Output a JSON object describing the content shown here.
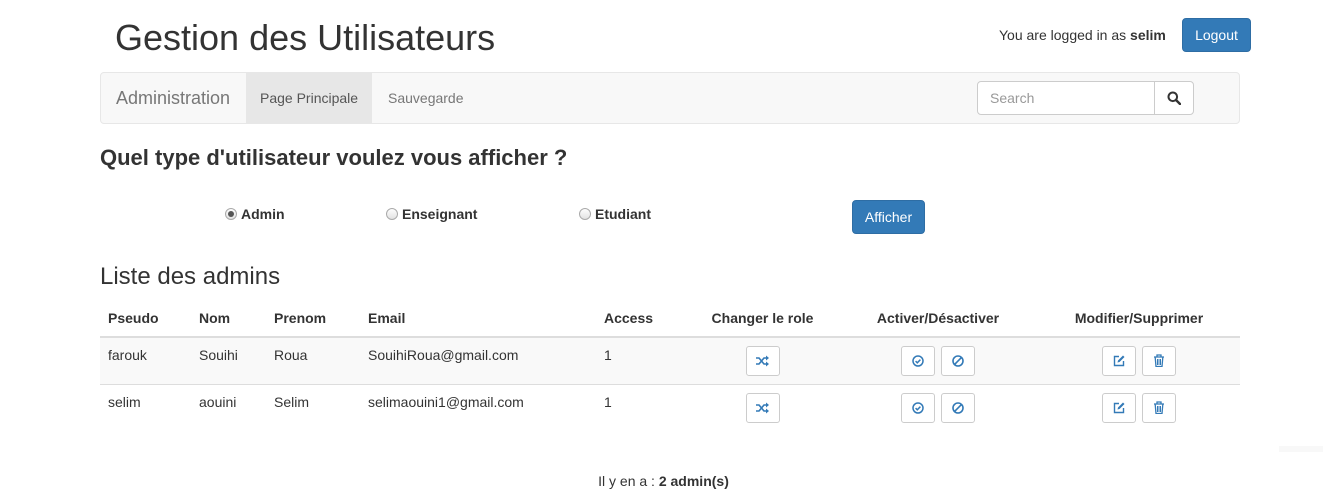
{
  "app_title": "Gestion des Utilisateurs",
  "login": {
    "prefix": "You are logged in as",
    "username": "selim",
    "logout_label": "Logout"
  },
  "navbar": {
    "brand": "Administration",
    "items": [
      {
        "label": "Page Principale",
        "active": true
      },
      {
        "label": "Sauvegarde",
        "active": false
      }
    ],
    "search": {
      "placeholder": "Search",
      "value": ""
    }
  },
  "filter": {
    "question": "Quel type d'utilisateur voulez vous afficher ?",
    "options": [
      {
        "label": "Admin",
        "selected": true
      },
      {
        "label": "Enseignant",
        "selected": false
      },
      {
        "label": "Etudiant",
        "selected": false
      }
    ],
    "submit_label": "Afficher"
  },
  "list": {
    "title": "Liste des admins",
    "columns": [
      "Pseudo",
      "Nom",
      "Prenom",
      "Email",
      "Access",
      "Changer le role",
      "Activer/Désactiver",
      "Modifier/Supprimer"
    ],
    "rows": [
      {
        "pseudo": "farouk",
        "nom": "Souihi",
        "prenom": "Roua",
        "email": "SouihiRoua@gmail.com",
        "access": "1"
      },
      {
        "pseudo": "selim",
        "nom": "aouini",
        "prenom": "Selim",
        "email": "selimaouini1@gmail.com",
        "access": "1"
      }
    ]
  },
  "footer": {
    "prefix": "Il y en a :",
    "count": "2 admin(s)"
  },
  "colors": {
    "primary": "#337ab7",
    "navbar_bg": "#f8f8f8",
    "active_nav_bg": "#e7e7e7",
    "icon_blue": "#337ab7"
  },
  "icons": {
    "search": "search-icon",
    "change_role": "shuffle-icon",
    "activate": "check-circle-icon",
    "deactivate": "ban-icon",
    "edit": "edit-icon",
    "delete": "trash-icon"
  }
}
